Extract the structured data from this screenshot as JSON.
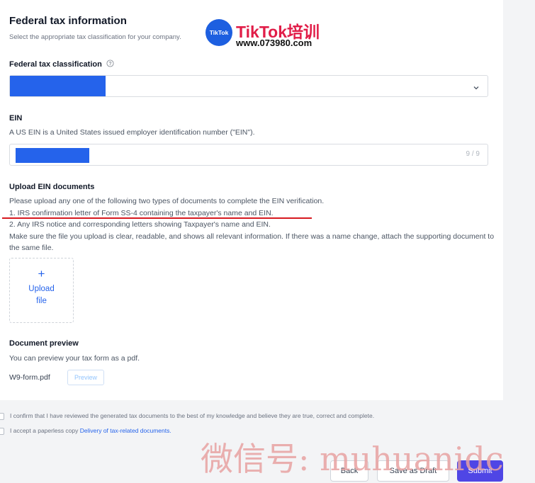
{
  "section": {
    "title": "Federal tax information",
    "subtitle": "Select the appropriate tax classification for your company."
  },
  "classification": {
    "label": "Federal tax classification",
    "help_icon": "question-circle-icon",
    "dropdown_icon": "chevron-down-icon"
  },
  "ein": {
    "label": "EIN",
    "description": "A US EIN is a United States issued employer identification number (\"EIN\").",
    "counter": "9 / 9"
  },
  "upload": {
    "title": "Upload EIN documents",
    "intro": "Please upload any one of the following two types of documents to complete the EIN verification.",
    "option1": "1. IRS confirmation letter of Form SS-4 containing the taxpayer's name and EIN.",
    "option2": "2. Any IRS notice and corresponding letters showing Taxpayer's name and EIN.",
    "note": "Make sure the file you upload is clear, readable, and shows all relevant information. If there was a name change, attach the supporting document to the same file.",
    "plus": "+",
    "button_line1": "Upload",
    "button_line2": "file"
  },
  "preview": {
    "title": "Document preview",
    "description": "You can preview your tax form as a pdf.",
    "filename": "W9-form.pdf",
    "button": "Preview"
  },
  "confirmations": {
    "confirm_text": "I confirm that I have reviewed the generated tax documents to the best of my knowledge and believe they are true, correct and complete.",
    "paperless_prefix": "I accept a paperless copy",
    "paperless_link": "Delivery of tax-related documents."
  },
  "actions": {
    "back": "Back",
    "save_draft": "Save as Draft",
    "submit": "Submit"
  },
  "watermarks": {
    "logo_text": "TikTok",
    "brand": "TikTok培训",
    "url": "www.073980.com",
    "wechat": "微信号: muhuanidc"
  },
  "colors": {
    "redaction": "#2563eb",
    "primary": "#4f46e5",
    "underline": "#d71920"
  }
}
